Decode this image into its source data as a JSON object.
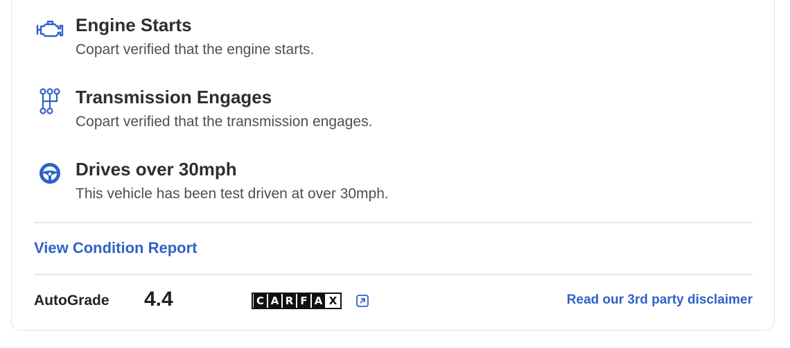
{
  "features": [
    {
      "title": "Engine Starts",
      "description": "Copart verified that the engine starts.",
      "icon": "engine-icon"
    },
    {
      "title": "Transmission Engages",
      "description": "Copart verified that the transmission engages.",
      "icon": "transmission-icon"
    },
    {
      "title": "Drives over 30mph",
      "description": "This vehicle has been test driven at over 30mph.",
      "icon": "steering-wheel-icon"
    }
  ],
  "links": {
    "view_condition_report": "View Condition Report",
    "third_party_disclaimer": "Read our 3rd party disclaimer"
  },
  "autograde": {
    "logo_text": "AutoGrade",
    "score": "4.4"
  },
  "carfax": {
    "logo_letters": [
      "C",
      "A",
      "R",
      "F",
      "A",
      "X"
    ],
    "external_link_icon": "external-link-icon"
  },
  "colors": {
    "accent": "#2f62c8",
    "icon": "#2f62c8",
    "text_primary": "#2b2f33",
    "text_secondary": "#4a4f55",
    "divider": "#e3e5e8"
  }
}
